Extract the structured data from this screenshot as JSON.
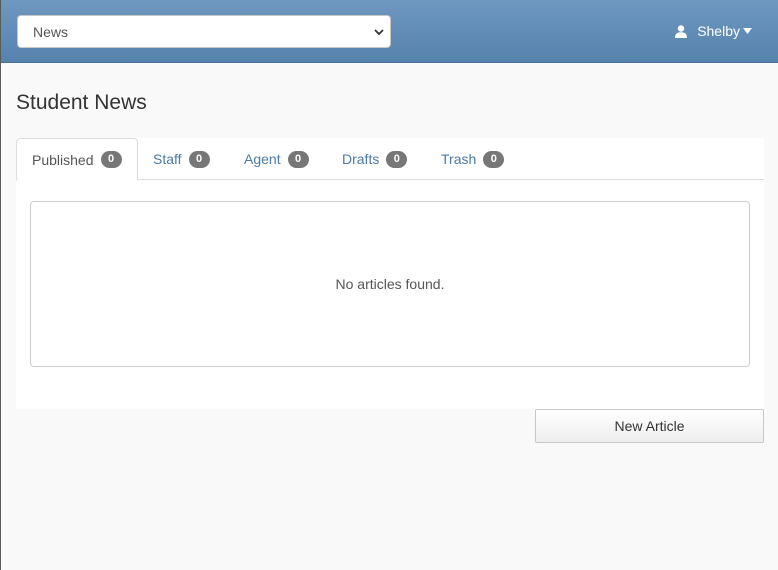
{
  "header": {
    "section_select": {
      "value": "News"
    },
    "user": {
      "name": "Shelby"
    }
  },
  "page": {
    "title": "Student News"
  },
  "tabs": [
    {
      "label": "Published",
      "count": "0",
      "active": true
    },
    {
      "label": "Staff",
      "count": "0",
      "active": false
    },
    {
      "label": "Agent",
      "count": "0",
      "active": false
    },
    {
      "label": "Drafts",
      "count": "0",
      "active": false
    },
    {
      "label": "Trash",
      "count": "0",
      "active": false
    }
  ],
  "articles": {
    "empty_message": "No articles found."
  },
  "actions": {
    "new_article_label": "New Article"
  },
  "colors": {
    "header_bar": "#6a93bb",
    "tab_link": "#4a7ba7",
    "badge": "#777777"
  }
}
